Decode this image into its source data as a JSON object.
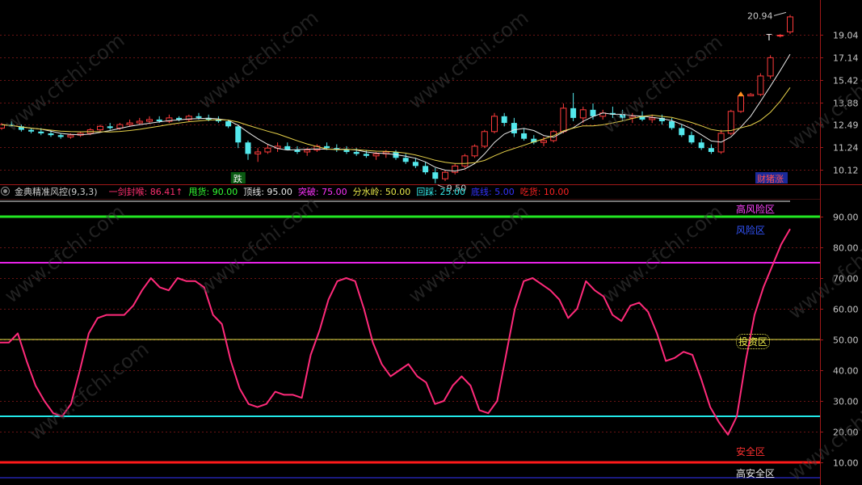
{
  "chart_data": [
    {
      "type": "candlestick",
      "price_axis_ticks": [
        20.94,
        19.04,
        17.14,
        15.42,
        13.88,
        12.49,
        11.24,
        10.12
      ],
      "annotations": {
        "high_label": "20.94",
        "low_label": "9.50",
        "fall_marker": "跌",
        "rise_marker": "财猪涨",
        "t_marker": "T"
      },
      "candles": [
        [
          12.3,
          12.6,
          12.2,
          12.5
        ],
        [
          12.5,
          12.7,
          12.4,
          12.4
        ],
        [
          12.4,
          12.5,
          12.1,
          12.2
        ],
        [
          12.2,
          12.3,
          12.0,
          12.1
        ],
        [
          12.1,
          12.3,
          11.9,
          12.0
        ],
        [
          12.0,
          12.2,
          11.8,
          11.9
        ],
        [
          11.9,
          12.0,
          11.7,
          11.8
        ],
        [
          11.8,
          12.0,
          11.7,
          11.9
        ],
        [
          11.9,
          12.1,
          11.8,
          12.0
        ],
        [
          12.0,
          12.3,
          11.9,
          12.2
        ],
        [
          12.2,
          12.5,
          12.1,
          12.4
        ],
        [
          12.4,
          12.6,
          12.2,
          12.3
        ],
        [
          12.3,
          12.6,
          12.2,
          12.5
        ],
        [
          12.5,
          12.8,
          12.4,
          12.6
        ],
        [
          12.6,
          12.9,
          12.5,
          12.7
        ],
        [
          12.7,
          13.0,
          12.6,
          12.8
        ],
        [
          12.8,
          13.0,
          12.6,
          12.7
        ],
        [
          12.7,
          13.1,
          12.6,
          12.9
        ],
        [
          12.9,
          13.0,
          12.7,
          12.8
        ],
        [
          12.8,
          13.1,
          12.7,
          13.0
        ],
        [
          13.0,
          13.2,
          12.8,
          12.9
        ],
        [
          12.9,
          13.1,
          12.7,
          12.8
        ],
        [
          12.8,
          13.0,
          12.6,
          12.7
        ],
        [
          12.7,
          12.8,
          12.3,
          12.4
        ],
        [
          12.4,
          12.5,
          11.2,
          11.5
        ],
        [
          11.5,
          11.6,
          10.6,
          10.9
        ],
        [
          10.9,
          11.2,
          10.5,
          11.0
        ],
        [
          11.0,
          11.4,
          10.9,
          11.2
        ],
        [
          11.2,
          11.5,
          11.0,
          11.3
        ],
        [
          11.3,
          11.5,
          11.1,
          11.1
        ],
        [
          11.1,
          11.3,
          10.9,
          11.0
        ],
        [
          11.0,
          11.2,
          10.8,
          11.1
        ],
        [
          11.1,
          11.4,
          11.0,
          11.3
        ],
        [
          11.3,
          11.5,
          11.1,
          11.2
        ],
        [
          11.2,
          11.4,
          11.0,
          11.1
        ],
        [
          11.1,
          11.3,
          10.9,
          11.0
        ],
        [
          11.0,
          11.2,
          10.8,
          10.9
        ],
        [
          10.9,
          11.1,
          10.7,
          10.8
        ],
        [
          10.8,
          11.0,
          10.6,
          10.9
        ],
        [
          10.9,
          11.1,
          10.7,
          11.0
        ],
        [
          11.0,
          11.1,
          10.6,
          10.7
        ],
        [
          10.7,
          10.9,
          10.4,
          10.5
        ],
        [
          10.5,
          10.7,
          10.2,
          10.3
        ],
        [
          10.3,
          10.5,
          9.9,
          10.0
        ],
        [
          10.0,
          10.2,
          9.5,
          9.7
        ],
        [
          9.7,
          10.1,
          9.6,
          10.0
        ],
        [
          10.0,
          10.4,
          9.9,
          10.3
        ],
        [
          10.3,
          10.9,
          10.2,
          10.8
        ],
        [
          10.8,
          11.4,
          10.7,
          11.3
        ],
        [
          11.3,
          12.2,
          11.2,
          12.1
        ],
        [
          12.1,
          13.2,
          12.0,
          13.0
        ],
        [
          13.0,
          13.2,
          12.4,
          12.6
        ],
        [
          12.6,
          12.9,
          11.8,
          12.0
        ],
        [
          12.0,
          12.3,
          11.6,
          11.7
        ],
        [
          11.7,
          11.9,
          11.4,
          11.5
        ],
        [
          11.5,
          11.8,
          11.3,
          11.6
        ],
        [
          11.6,
          12.2,
          11.5,
          12.1
        ],
        [
          12.1,
          13.8,
          12.0,
          13.5
        ],
        [
          13.5,
          14.5,
          12.7,
          12.9
        ],
        [
          12.9,
          13.6,
          12.6,
          13.4
        ],
        [
          13.4,
          13.8,
          12.8,
          13.0
        ],
        [
          13.0,
          13.4,
          12.8,
          13.2
        ],
        [
          13.2,
          13.6,
          12.9,
          13.1
        ],
        [
          13.1,
          13.4,
          12.7,
          12.9
        ],
        [
          12.9,
          13.2,
          12.6,
          13.0
        ],
        [
          13.0,
          13.3,
          12.7,
          12.8
        ],
        [
          12.8,
          13.1,
          12.6,
          12.9
        ],
        [
          12.9,
          13.1,
          12.5,
          12.7
        ],
        [
          12.7,
          12.9,
          12.2,
          12.3
        ],
        [
          12.3,
          12.5,
          11.8,
          11.9
        ],
        [
          11.9,
          12.1,
          11.4,
          11.5
        ],
        [
          11.5,
          11.7,
          11.1,
          11.2
        ],
        [
          11.2,
          11.4,
          10.9,
          11.0
        ],
        [
          11.0,
          12.2,
          10.9,
          12.0
        ],
        [
          12.0,
          13.4,
          11.9,
          13.3
        ],
        [
          13.3,
          14.5,
          13.2,
          14.3
        ],
        [
          14.3,
          14.5,
          14.3,
          14.4
        ],
        [
          14.4,
          15.9,
          14.3,
          15.7
        ],
        [
          15.7,
          17.3,
          15.5,
          17.1
        ],
        [
          19.0,
          19.1,
          18.8,
          19.0
        ],
        [
          19.3,
          20.9,
          19.1,
          20.7
        ]
      ],
      "ma_series": [
        {
          "color": "#e8e8e8",
          "name": ""
        },
        {
          "color": "#e8d24a",
          "name": ""
        }
      ]
    },
    {
      "type": "line",
      "indicator_name": "金典精准风控(9,3,3)",
      "legend": [
        {
          "label": "一剑封喉",
          "value": "86.41",
          "suffix": "↑",
          "color": "#ff3070"
        },
        {
          "label": "甩货",
          "value": "90.00",
          "color": "#33ff33"
        },
        {
          "label": "顶线",
          "value": "95.00",
          "color": "#e8e8e8"
        },
        {
          "label": "突破",
          "value": "75.00",
          "color": "#ff33ff"
        },
        {
          "label": "分水岭",
          "value": "50.00",
          "color": "#e8e84a"
        },
        {
          "label": "回踩",
          "value": "25.00",
          "color": "#33e8e8"
        },
        {
          "label": "底线",
          "value": "5.00",
          "color": "#3333ff"
        },
        {
          "label": "吃货",
          "value": "10.00",
          "color": "#ff2222"
        }
      ],
      "y_ticks": [
        90,
        80,
        70,
        60,
        50,
        40,
        30,
        20,
        10
      ],
      "ylim": [
        5,
        95
      ],
      "reference_lines": [
        {
          "value": 95,
          "color": "#e8e8e8"
        },
        {
          "value": 90,
          "color": "#22e822"
        },
        {
          "value": 75,
          "color": "#e822e8"
        },
        {
          "value": 50,
          "color": "#e8e84a"
        },
        {
          "value": 25,
          "color": "#22e8e8"
        },
        {
          "value": 10,
          "color": "#ff1a1a"
        },
        {
          "value": 5,
          "color": "#3333ff"
        }
      ],
      "zone_labels": [
        {
          "text": "高风险区",
          "color": "#ff44ff"
        },
        {
          "text": "风险区",
          "color": "#3355ff"
        },
        {
          "text": "投资区",
          "color": "#e8e84a"
        },
        {
          "text": "安全区",
          "color": "#ff3030"
        },
        {
          "text": "高安全区",
          "color": "#e8e8e8"
        }
      ],
      "line_color": "#ff2a7a",
      "values": [
        49,
        49,
        52,
        43,
        35,
        30,
        26,
        25,
        29,
        40,
        52,
        57,
        58,
        58,
        58,
        61,
        66,
        70,
        67,
        66,
        70,
        69,
        69,
        67,
        58,
        55,
        43,
        34,
        29,
        28,
        29,
        33,
        32,
        32,
        31,
        45,
        53,
        63,
        69,
        70,
        69,
        60,
        49,
        42,
        38,
        40,
        42,
        38,
        36,
        29,
        30,
        35,
        38,
        35,
        27,
        26,
        30,
        45,
        60,
        69,
        70,
        68,
        66,
        63,
        57,
        60,
        69,
        66,
        64,
        58,
        56,
        61,
        62,
        59,
        52,
        43,
        44,
        46,
        45,
        37,
        28,
        23,
        19,
        25,
        43,
        58,
        67,
        74,
        81,
        86
      ]
    }
  ]
}
